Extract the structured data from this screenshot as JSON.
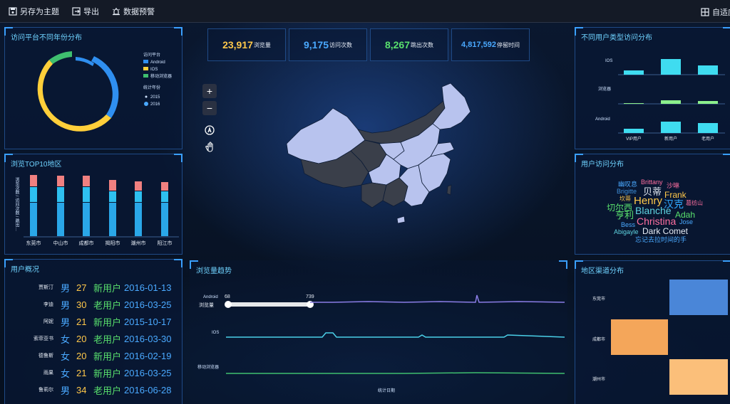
{
  "toolbar": {
    "save_theme": "另存为主题",
    "export": "导出",
    "data_alert": "数据预警",
    "adaptive": "自适应"
  },
  "panels": {
    "platform_year": "访问平台不同年份分布",
    "top10": "浏览TOP10地区",
    "users": "用户概况",
    "user_type": "不同用户类型访问分布",
    "visit_dist": "用户访问分布",
    "channel": "地区渠道分布",
    "trend": "浏览量趋势"
  },
  "kpis": [
    {
      "value": "23,917",
      "label": "浏览量",
      "color": "#ffc84a"
    },
    {
      "value": "9,175",
      "label": "访问次数",
      "color": "#4aa9ff"
    },
    {
      "value": "8,267",
      "label": "跳出次数",
      "color": "#59e06d"
    },
    {
      "value": "4,817,592",
      "label": "停留时间",
      "color": "#4aa9ff"
    }
  ],
  "donut": {
    "legend_platform_title": "访问平台",
    "legend_items": [
      {
        "name": "Android",
        "color": "#2f8ff0"
      },
      {
        "name": "IOS",
        "color": "#ffcf3a"
      },
      {
        "name": "移动浏览器",
        "color": "#3fbf6f"
      }
    ],
    "legend_year_title": "统计年份",
    "years": [
      "2015",
      "2016"
    ]
  },
  "top10": {
    "ylabel": "浏览次数 / 访问次数 / 跳出…",
    "cities": [
      "东莞市",
      "中山市",
      "成都市",
      "揭阳市",
      "潮州市",
      "阳江市"
    ]
  },
  "users": [
    {
      "name": "贾斯汀",
      "gender": "男",
      "age": "27",
      "type": "新用户",
      "date": "2016-01-13"
    },
    {
      "name": "李迪",
      "gender": "男",
      "age": "30",
      "type": "老用户",
      "date": "2016-03-25"
    },
    {
      "name": "阿妮",
      "gender": "男",
      "age": "21",
      "type": "新用户",
      "date": "2015-10-17"
    },
    {
      "name": "索菲亚书",
      "gender": "女",
      "age": "20",
      "type": "老用户",
      "date": "2016-03-30"
    },
    {
      "name": "德鲁斯",
      "gender": "女",
      "age": "20",
      "type": "新用户",
      "date": "2016-02-19"
    },
    {
      "name": "雨果",
      "gender": "女",
      "age": "21",
      "type": "新用户",
      "date": "2016-03-25"
    },
    {
      "name": "鲁莉尔",
      "gender": "男",
      "age": "34",
      "type": "老用户",
      "date": "2016-06-28"
    }
  ],
  "user_type": {
    "rows": [
      "IOS",
      "浏览器",
      "Android"
    ],
    "cols": [
      "VIP用户",
      "新用户",
      "老用户"
    ]
  },
  "wordcloud": [
    {
      "t": "幽叹息",
      "c": "#4aa9ff",
      "s": 9
    },
    {
      "t": "Brittany",
      "c": "#ff6fa0",
      "s": 9
    },
    {
      "t": "沙琳",
      "c": "#ff6fa0",
      "s": 9
    },
    {
      "t": "Brigitte",
      "c": "#3f8fd8",
      "s": 9
    },
    {
      "t": "贝蒂",
      "c": "#e6ecf5",
      "s": 13
    },
    {
      "t": "Frank",
      "c": "#ffc84a",
      "s": 12
    },
    {
      "t": "坎蒂",
      "c": "#ffc84a",
      "s": 8
    },
    {
      "t": "Henry",
      "c": "#ffc84a",
      "s": 15
    },
    {
      "t": "葛纺山",
      "c": "#ff6fa0",
      "s": 8
    },
    {
      "t": "切尔西",
      "c": "#59e06d",
      "s": 12
    },
    {
      "t": "汉克",
      "c": "#2fa8ff",
      "s": 14
    },
    {
      "t": "亨利",
      "c": "#59e06d",
      "s": 13
    },
    {
      "t": "Blanche",
      "c": "#5fd3e0",
      "s": 14
    },
    {
      "t": "Adah",
      "c": "#59e06d",
      "s": 12
    },
    {
      "t": "Bess",
      "c": "#4aa9ff",
      "s": 9
    },
    {
      "t": "Christina",
      "c": "#ff6fa0",
      "s": 14
    },
    {
      "t": "Jose",
      "c": "#4aa9ff",
      "s": 9
    },
    {
      "t": "Abigayle",
      "c": "#5fd3e0",
      "s": 9
    },
    {
      "t": "Dark Comet",
      "c": "#e6ecf5",
      "s": 12
    },
    {
      "t": "忘记去拉时间的手",
      "c": "#4aa9ff",
      "s": 9
    }
  ],
  "trend": {
    "labels": [
      "Android",
      "浏览量",
      "IOS",
      "移动浏览器"
    ],
    "slider_min": "68",
    "slider_max": "739",
    "xlabel": "统计日期"
  },
  "channel": {
    "cities": [
      "东莞市",
      "成都市",
      "潮州市"
    ]
  },
  "map_controls": [
    "+",
    "−"
  ]
}
